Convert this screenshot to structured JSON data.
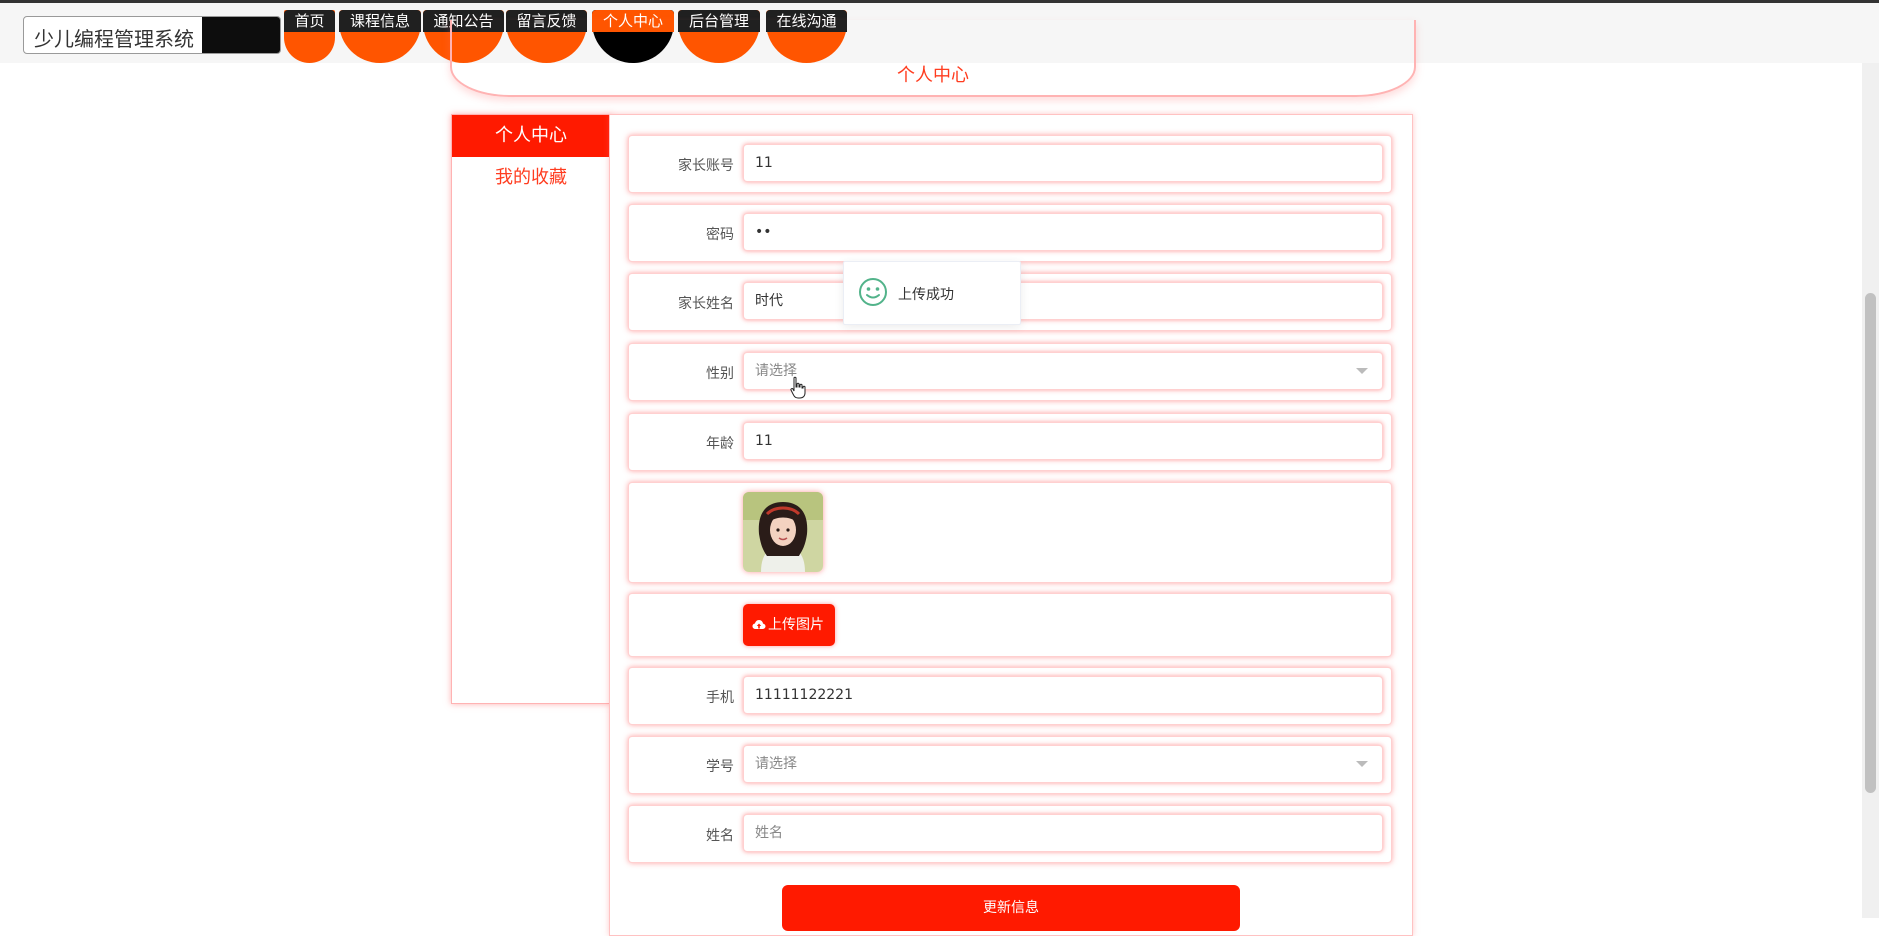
{
  "header": {
    "brand": "少儿编程管理系统",
    "nav": [
      {
        "label": "首页"
      },
      {
        "label": "课程信息"
      },
      {
        "label": "通知公告"
      },
      {
        "label": "留言反馈"
      },
      {
        "label": "个人中心"
      },
      {
        "label": "后台管理"
      },
      {
        "label": "在线沟通"
      }
    ]
  },
  "banner": {
    "title": "个人中心"
  },
  "sidebar": {
    "active": "个人中心",
    "link": "我的收藏"
  },
  "form": {
    "account": {
      "label": "家长账号",
      "value": "11"
    },
    "password": {
      "label": "密码",
      "value": "••"
    },
    "name": {
      "label": "家长姓名",
      "value": "时代"
    },
    "gender": {
      "label": "性别",
      "placeholder": "请选择"
    },
    "age": {
      "label": "年龄",
      "value": "11"
    },
    "upload_label": "上传图片",
    "phone": {
      "label": "手机",
      "value": "11111122221"
    },
    "student_id": {
      "label": "学号",
      "placeholder": "请选择"
    },
    "student_name": {
      "label": "姓名",
      "placeholder": "姓名"
    },
    "submit_label": "更新信息"
  },
  "toast": {
    "message": "上传成功"
  },
  "colors": {
    "accent": "#ff1a00",
    "nav_orange": "#ff5500",
    "nav_dark": "#202020",
    "success": "#52b38a"
  }
}
